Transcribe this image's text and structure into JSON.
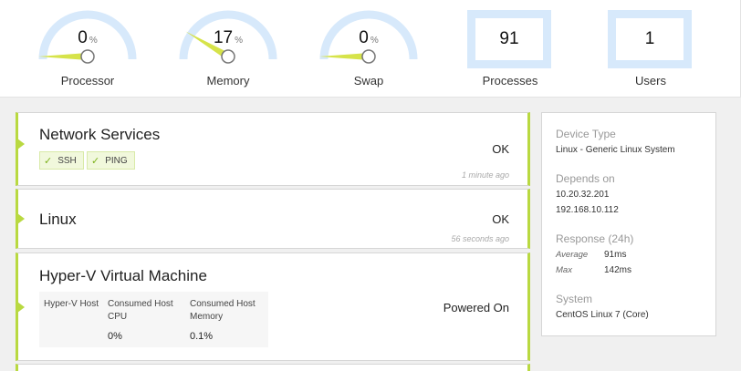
{
  "metrics": {
    "processor": {
      "label": "Processor",
      "value": "0",
      "unit": "%",
      "percent": 0
    },
    "memory": {
      "label": "Memory",
      "value": "17",
      "unit": "%",
      "percent": 17
    },
    "swap": {
      "label": "Swap",
      "value": "0",
      "unit": "%",
      "percent": 0
    },
    "processes": {
      "label": "Processes",
      "value": "91"
    },
    "users": {
      "label": "Users",
      "value": "1"
    }
  },
  "services": [
    {
      "title": "Network Services",
      "status": "OK",
      "time": "1 minute ago",
      "tags": [
        "SSH",
        "PING"
      ]
    },
    {
      "title": "Linux",
      "status": "OK",
      "time": "56 seconds ago"
    },
    {
      "title": "Hyper-V Virtual Machine",
      "status": "Powered On",
      "columns": [
        "Hyper-V Host",
        "Consumed Host CPU",
        "Consumed Host Memory"
      ],
      "values": [
        "",
        "0%",
        "0.1%"
      ]
    }
  ],
  "info": {
    "device_type_label": "Device Type",
    "device_type": "Linux - Generic Linux System",
    "depends_label": "Depends on",
    "depends": [
      "10.20.32.201",
      "192.168.10.112"
    ],
    "response_label": "Response (24h)",
    "average_label": "Average",
    "average": "91ms",
    "max_label": "Max",
    "max": "142ms",
    "system_label": "System",
    "system": "CentOS Linux 7 (Core)"
  },
  "colors": {
    "accent": "#b9d941",
    "gauge_track": "#d7e9fb",
    "gauge_needle": "#d6e34a",
    "tag_bg": "#f1f8dc"
  }
}
